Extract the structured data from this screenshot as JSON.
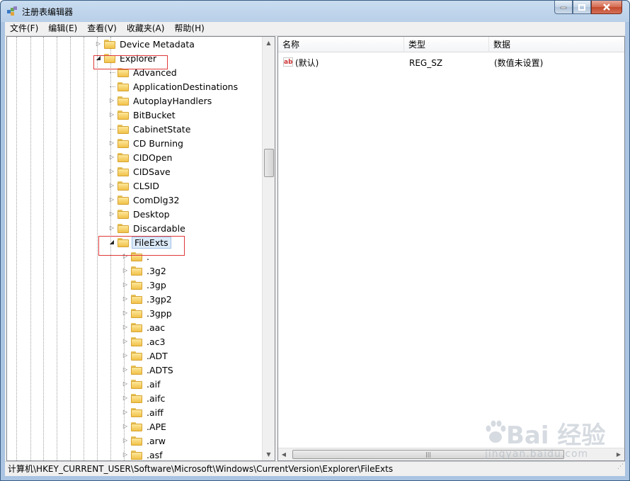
{
  "window": {
    "title": "注册表编辑器"
  },
  "menu": [
    "文件(F)",
    "编辑(E)",
    "查看(V)",
    "收藏夹(A)",
    "帮助(H)"
  ],
  "tree": [
    {
      "label": "Device Metadata",
      "expander": "▷",
      "level": 1
    },
    {
      "label": "Explorer",
      "expander": "◢",
      "level": 1
    },
    {
      "label": "Advanced",
      "expander": "",
      "level": 2
    },
    {
      "label": "ApplicationDestinations",
      "expander": "",
      "level": 2
    },
    {
      "label": "AutoplayHandlers",
      "expander": "▷",
      "level": 2
    },
    {
      "label": "BitBucket",
      "expander": "▷",
      "level": 2
    },
    {
      "label": "CabinetState",
      "expander": "",
      "level": 2
    },
    {
      "label": "CD Burning",
      "expander": "▷",
      "level": 2
    },
    {
      "label": "CIDOpen",
      "expander": "▷",
      "level": 2
    },
    {
      "label": "CIDSave",
      "expander": "▷",
      "level": 2
    },
    {
      "label": "CLSID",
      "expander": "▷",
      "level": 2
    },
    {
      "label": "ComDlg32",
      "expander": "▷",
      "level": 2
    },
    {
      "label": "Desktop",
      "expander": "▷",
      "level": 2
    },
    {
      "label": "Discardable",
      "expander": "▷",
      "level": 2
    },
    {
      "label": "FileExts",
      "expander": "◢",
      "level": 2,
      "selected": true
    },
    {
      "label": ".",
      "expander": "▷",
      "level": 3
    },
    {
      "label": ".3g2",
      "expander": "▷",
      "level": 3
    },
    {
      "label": ".3gp",
      "expander": "▷",
      "level": 3
    },
    {
      "label": ".3gp2",
      "expander": "▷",
      "level": 3
    },
    {
      "label": ".3gpp",
      "expander": "▷",
      "level": 3
    },
    {
      "label": ".aac",
      "expander": "▷",
      "level": 3
    },
    {
      "label": ".ac3",
      "expander": "▷",
      "level": 3
    },
    {
      "label": ".ADT",
      "expander": "▷",
      "level": 3
    },
    {
      "label": ".ADTS",
      "expander": "▷",
      "level": 3
    },
    {
      "label": ".aif",
      "expander": "▷",
      "level": 3
    },
    {
      "label": ".aifc",
      "expander": "▷",
      "level": 3
    },
    {
      "label": ".aiff",
      "expander": "▷",
      "level": 3
    },
    {
      "label": ".APE",
      "expander": "▷",
      "level": 3
    },
    {
      "label": ".arw",
      "expander": "▷",
      "level": 3
    },
    {
      "label": ".asf",
      "expander": "▷",
      "level": 3
    }
  ],
  "list": {
    "columns": [
      "名称",
      "类型",
      "数据"
    ],
    "rows": [
      {
        "name": "(默认)",
        "type": "REG_SZ",
        "data": "(数值未设置)"
      }
    ]
  },
  "status": "计算机\\HKEY_CURRENT_USER\\Software\\Microsoft\\Windows\\CurrentVersion\\Explorer\\FileExts",
  "watermark": {
    "text": "Bai 经验",
    "sub": "jingyan.baidu.com"
  }
}
